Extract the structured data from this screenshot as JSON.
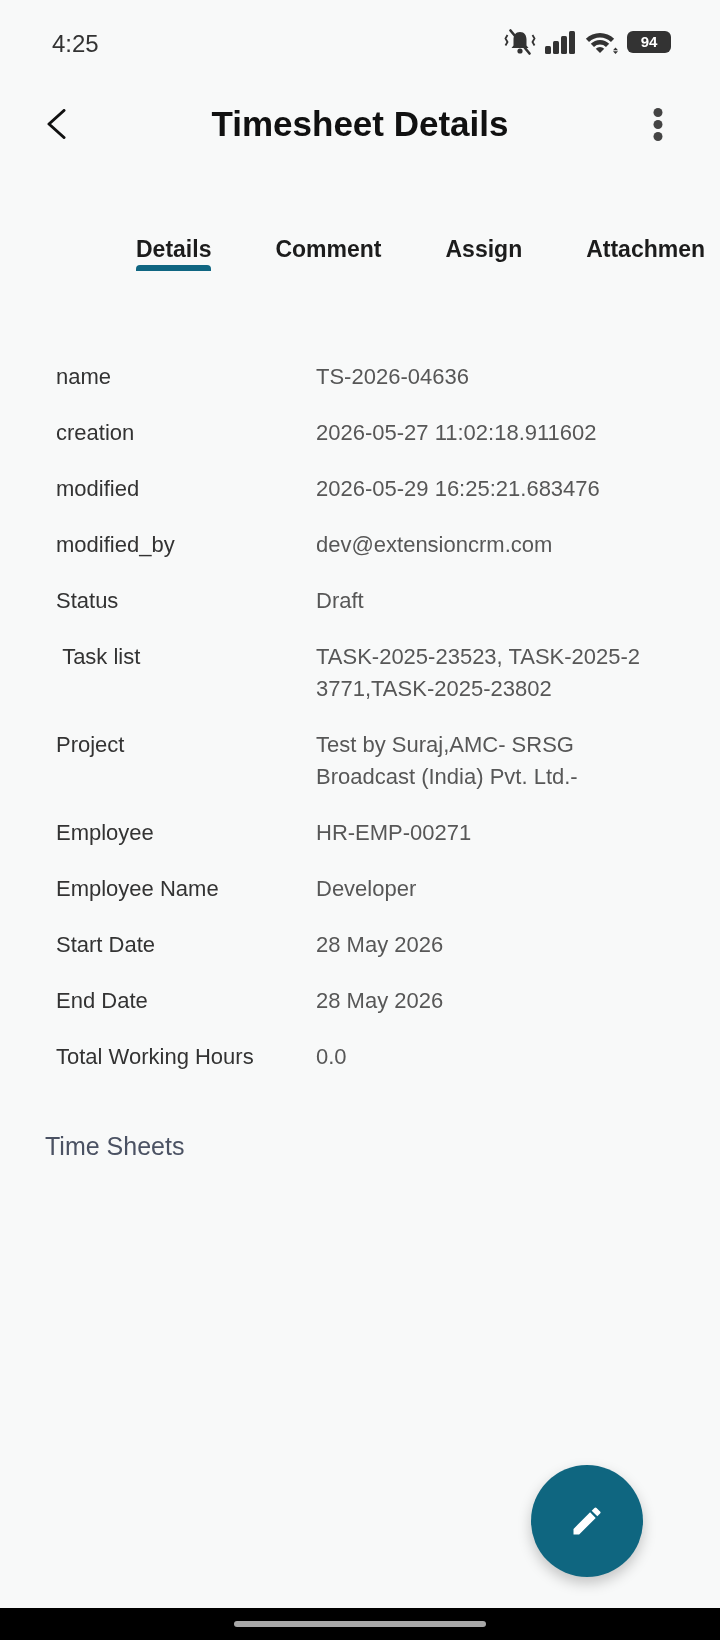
{
  "status_bar": {
    "time": "4:25",
    "battery": "94"
  },
  "header": {
    "title": "Timesheet Details"
  },
  "tabs": [
    {
      "label": "Details",
      "selected": true
    },
    {
      "label": "Comment",
      "selected": false
    },
    {
      "label": "Assign",
      "selected": false
    },
    {
      "label": "Attachmen",
      "selected": false
    }
  ],
  "details": [
    {
      "label": "name",
      "value": "TS-2026-04636",
      "kind": "text"
    },
    {
      "label": "creation",
      "value": "2026-05-27 11:02:18.911602",
      "kind": "text"
    },
    {
      "label": "modified",
      "value": "2026-05-29 16:25:21.683476",
      "kind": "text"
    },
    {
      "label": "modified_by",
      "value": "dev@extensioncrm.com",
      "kind": "text"
    },
    {
      "label": "Status",
      "value": "Draft",
      "kind": "text"
    },
    {
      "label": " Task list",
      "value": "TASK-2025-23523, TASK-2025-23771,TASK-2025-23802",
      "kind": "id_list"
    },
    {
      "label": "Project",
      "value": "Test by Suraj,AMC- SRSG Broadcast (India) Pvt. Ltd.-",
      "kind": "text"
    },
    {
      "label": "Employee",
      "value": "HR-EMP-00271",
      "kind": "text"
    },
    {
      "label": "Employee Name",
      "value": "Developer",
      "kind": "text"
    },
    {
      "label": "Start Date",
      "value": "28 May 2026",
      "kind": "text"
    },
    {
      "label": "End Date",
      "value": "28 May 2026",
      "kind": "text"
    },
    {
      "label": "Total Working Hours",
      "value": "0.0",
      "kind": "text"
    }
  ],
  "section": {
    "title": "Time Sheets"
  }
}
